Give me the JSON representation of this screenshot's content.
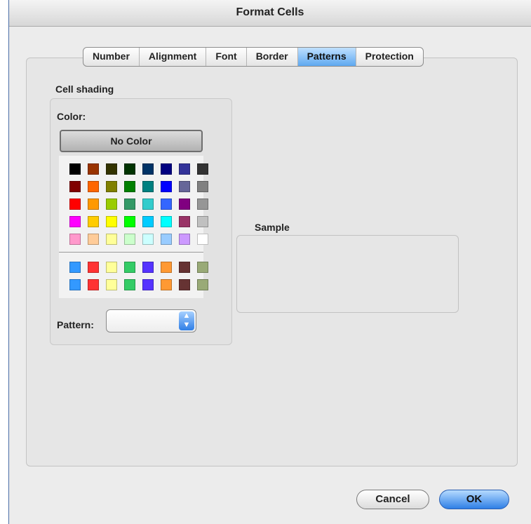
{
  "window": {
    "title": "Format Cells"
  },
  "tabs": [
    {
      "label": "Number",
      "active": false
    },
    {
      "label": "Alignment",
      "active": false
    },
    {
      "label": "Font",
      "active": false
    },
    {
      "label": "Border",
      "active": false
    },
    {
      "label": "Patterns",
      "active": true
    },
    {
      "label": "Protection",
      "active": false
    }
  ],
  "cell_shading": {
    "group_label": "Cell shading",
    "color_label": "Color:",
    "no_color_label": "No Color",
    "palette_rows": [
      [
        "#000000",
        "#993300",
        "#333300",
        "#003300",
        "#003366",
        "#000080",
        "#333399",
        "#333333"
      ],
      [
        "#800000",
        "#ff6600",
        "#808000",
        "#008000",
        "#008080",
        "#0000ff",
        "#666699",
        "#808080"
      ],
      [
        "#ff0000",
        "#ff9900",
        "#99cc00",
        "#339966",
        "#33cccc",
        "#3366ff",
        "#800080",
        "#969696"
      ],
      [
        "#ff00ff",
        "#ffcc00",
        "#ffff00",
        "#00ff00",
        "#00ccff",
        "#00ffff",
        "#993366",
        "#c0c0c0"
      ],
      [
        "#ff99cc",
        "#ffcc99",
        "#ffff99",
        "#ccffcc",
        "#ccffff",
        "#99ccff",
        "#cc99ff",
        "#ffffff"
      ]
    ],
    "chart_rows": [
      [
        "#3399ff",
        "#ff3333",
        "#ffff99",
        "#33cc66",
        "#5533ff",
        "#ff9933",
        "#663333",
        "#99aa77"
      ],
      [
        "#3399ff",
        "#ff3333",
        "#ffff99",
        "#33cc66",
        "#5533ff",
        "#ff9933",
        "#663333",
        "#99aa77"
      ]
    ],
    "pattern_label": "Pattern:",
    "pattern_value": ""
  },
  "sample": {
    "label": "Sample"
  },
  "buttons": {
    "cancel": "Cancel",
    "ok": "OK"
  }
}
